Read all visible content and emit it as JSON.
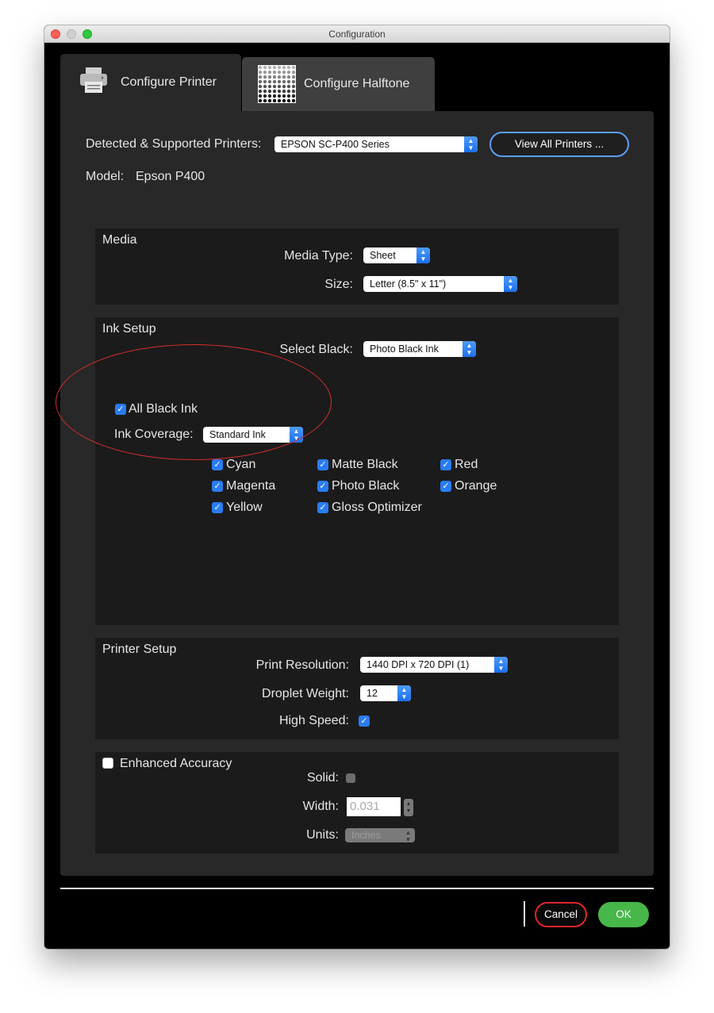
{
  "window": {
    "title": "Configuration"
  },
  "tabs": [
    {
      "label": "Configure Printer",
      "icon": "printer-icon",
      "active": true
    },
    {
      "label": "Configure Halftone",
      "icon": "halftone-icon",
      "active": false
    }
  ],
  "printer": {
    "detected_label": "Detected & Supported Printers:",
    "detected_value": "EPSON SC-P400 Series",
    "view_all_label": "View All Printers ...",
    "model_label": "Model:",
    "model_value": "Epson P400"
  },
  "media": {
    "title": "Media",
    "type_label": "Media Type:",
    "type_value": "Sheet",
    "size_label": "Size:",
    "size_value": "Letter (8.5\" x 11\")"
  },
  "ink": {
    "title": "Ink Setup",
    "select_black_label": "Select Black:",
    "select_black_value": "Photo Black Ink",
    "all_black_label": "All Black Ink",
    "coverage_label": "Ink Coverage:",
    "coverage_value": "Standard Ink",
    "inks": [
      {
        "label": "Cyan",
        "checked": true
      },
      {
        "label": "Magenta",
        "checked": true
      },
      {
        "label": "Yellow",
        "checked": true
      },
      {
        "label": "Matte Black",
        "checked": true
      },
      {
        "label": "Photo Black",
        "checked": true
      },
      {
        "label": "Gloss Optimizer",
        "checked": true
      },
      {
        "label": "Red",
        "checked": true
      },
      {
        "label": "Orange",
        "checked": true
      }
    ]
  },
  "printer_setup": {
    "title": "Printer Setup",
    "resolution_label": "Print Resolution:",
    "resolution_value": "1440 DPI x 720 DPI (1)",
    "droplet_label": "Droplet Weight:",
    "droplet_value": "12",
    "high_speed_label": "High Speed:",
    "high_speed_checked": true
  },
  "enhanced": {
    "title": "Enhanced Accuracy",
    "checked": false,
    "solid_label": "Solid:",
    "width_label": "Width:",
    "width_value": "0.031",
    "units_label": "Units:",
    "units_value": "Inches"
  },
  "footer": {
    "cancel_label": "Cancel",
    "ok_label": "OK"
  },
  "colors": {
    "accent": "#2a7cf4",
    "ok": "#47b74a",
    "cancel_border": "#e0242c",
    "annotation": "#d62d2d"
  }
}
